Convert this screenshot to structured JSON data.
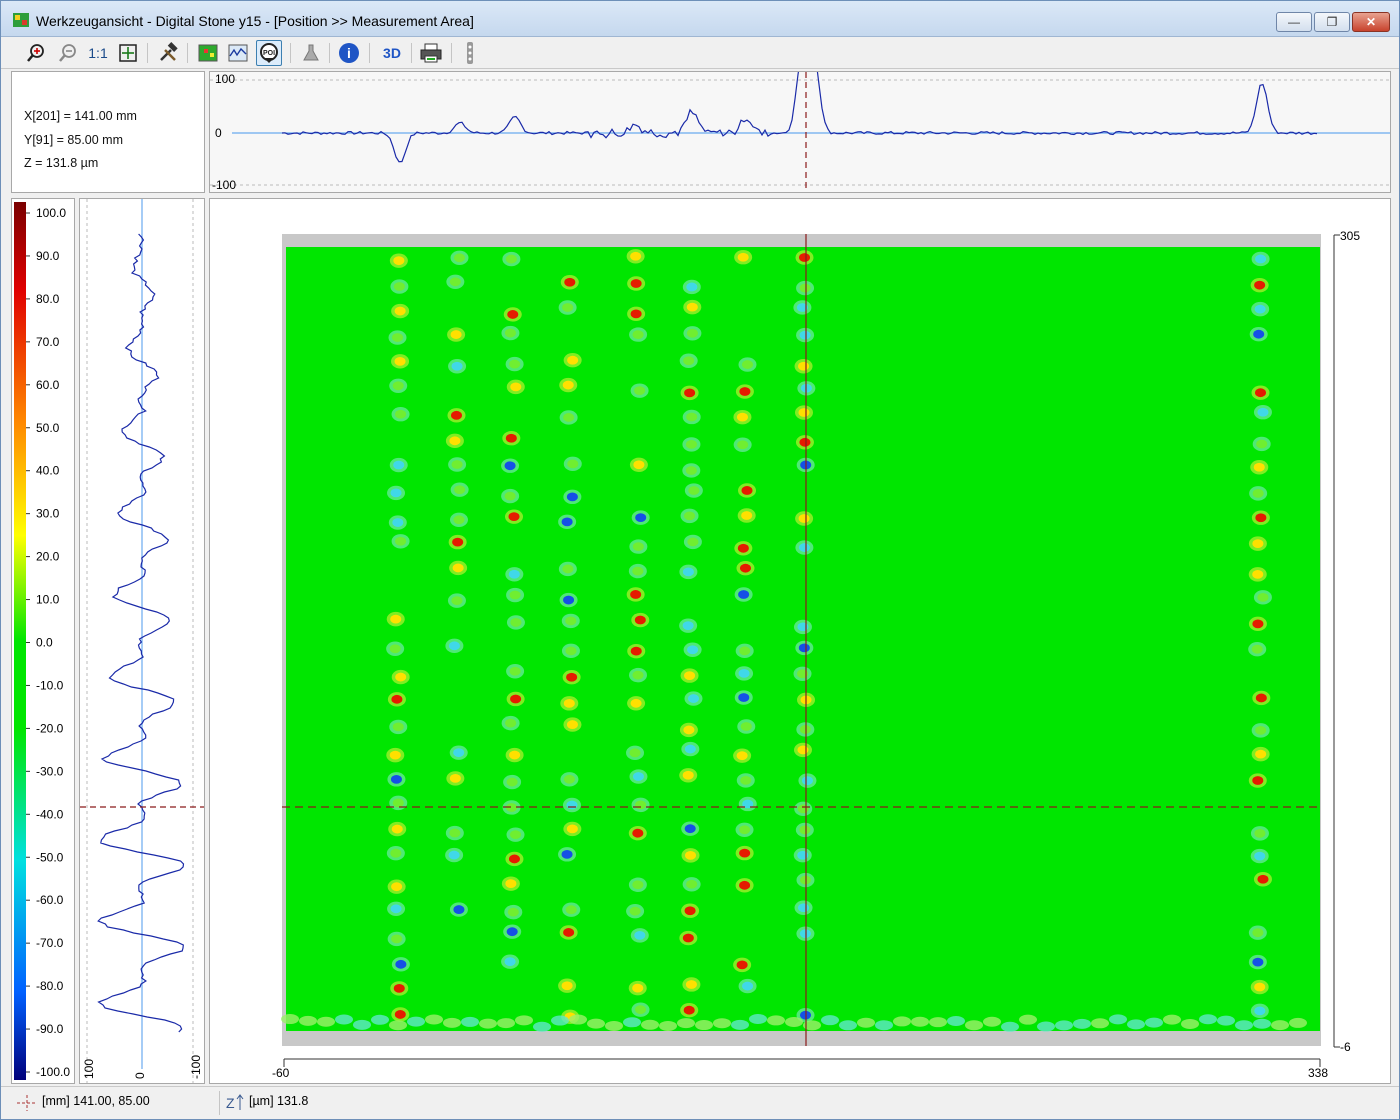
{
  "window": {
    "title": "Werkzeugansicht - Digital Stone y15 - [Position >> Measurement Area]",
    "minimize_icon": "minimize-icon",
    "maximize_icon": "maximize-icon",
    "close_icon": "close-icon"
  },
  "toolbar": {
    "items": [
      {
        "name": "zoom-in-icon"
      },
      {
        "name": "zoom-out-icon"
      },
      {
        "name": "actual-size",
        "label": "1:1"
      },
      {
        "name": "fit-icon"
      },
      {
        "name": "tools-icon"
      },
      {
        "name": "color-map-icon"
      },
      {
        "name": "profile-view-icon"
      },
      {
        "name": "poi-icon",
        "label": "POI",
        "active": true
      },
      {
        "name": "filter-icon"
      },
      {
        "name": "info-icon",
        "label": "i"
      },
      {
        "name": "view-3d",
        "label": "3D"
      },
      {
        "name": "print-icon"
      },
      {
        "name": "more-icon"
      }
    ]
  },
  "info": {
    "x_line": "X[201] = 141.00 mm",
    "y_line": "Y[91] = 85.00 mm",
    "z_line": "Z = 131.8 µm"
  },
  "top_profile": {
    "tick_labels": [
      "100",
      "0",
      "-100"
    ]
  },
  "left_profile": {
    "tick_labels": [
      "100",
      "0",
      "-100"
    ]
  },
  "color_scale": {
    "labels": [
      "100.0",
      "90.0",
      "80.0",
      "70.0",
      "60.0",
      "50.0",
      "40.0",
      "30.0",
      "20.0",
      "10.0",
      "0.0",
      "-10.0",
      "-20.0",
      "-30.0",
      "-40.0",
      "-50.0",
      "-60.0",
      "-70.0",
      "-80.0",
      "-90.0",
      "-100.0"
    ],
    "min": -100,
    "max": 100
  },
  "main": {
    "x_min_label": "-60",
    "x_max_label": "338",
    "y_max_label": "305",
    "y_min_label": "-6",
    "background_color": "#00e600",
    "cursor_color": "#8b1a1a"
  },
  "status": {
    "position_text": "[mm] 141.00, 85.00",
    "z_text": "[µm] 131.8"
  },
  "chart_data": {
    "type": "heatmap",
    "title": "",
    "xlim": [
      -60,
      338
    ],
    "ylim": [
      -6,
      305
    ],
    "zlim": [
      -100,
      100
    ],
    "cursor": {
      "x": 141.0,
      "y": 85.0,
      "z": 131.8
    },
    "top_profile_ylim": [
      -100,
      100
    ],
    "left_profile_xlim": [
      -100,
      100
    ]
  }
}
